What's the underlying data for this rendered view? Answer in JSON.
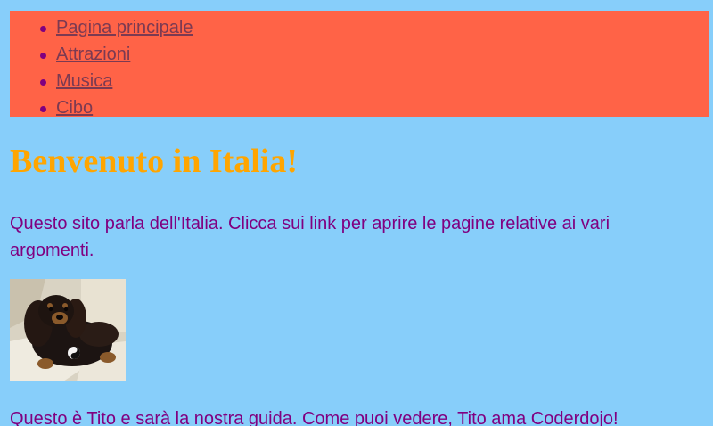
{
  "nav": {
    "items": [
      {
        "label": "Pagina principale"
      },
      {
        "label": "Attrazioni"
      },
      {
        "label": "Musica"
      },
      {
        "label": "Cibo"
      }
    ]
  },
  "main": {
    "heading": "Benvenuto in Italia!",
    "intro": "Questo sito parla dell'Italia. Clicca sui link per aprire le pagine relative ai vari argomenti.",
    "photo_icon": "dog-photo",
    "caption": "Questo è Tito e sarà la nostra guida. Come puoi vedere, Tito ama Coderdojo!"
  },
  "colors": {
    "page_background": "#87cefa",
    "nav_background": "#ff6347",
    "heading": "#ffa500",
    "text": "#800080",
    "link": "#7b3a52"
  }
}
